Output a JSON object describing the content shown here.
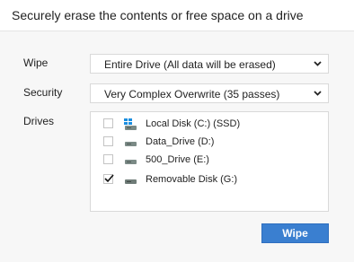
{
  "header": {
    "title": "Securely erase the contents or free space on a drive"
  },
  "form": {
    "wipe": {
      "label": "Wipe",
      "value": "Entire Drive (All data will be erased)"
    },
    "security": {
      "label": "Security",
      "value": "Very Complex Overwrite (35 passes)"
    },
    "drives": {
      "label": "Drives",
      "items": [
        {
          "name": "Local Disk (C:) (SSD)",
          "checked": false,
          "icon": "windows-drive-icon"
        },
        {
          "name": "Data_Drive (D:)",
          "checked": false,
          "icon": "hard-drive-icon"
        },
        {
          "name": "500_Drive (E:)",
          "checked": false,
          "icon": "hard-drive-icon"
        },
        {
          "name": "Removable Disk (G:)",
          "checked": true,
          "icon": "removable-drive-icon"
        }
      ]
    }
  },
  "actions": {
    "wipe_label": "Wipe"
  },
  "colors": {
    "accent": "#3a7fd0",
    "windows_logo": "#1a8ee0"
  }
}
